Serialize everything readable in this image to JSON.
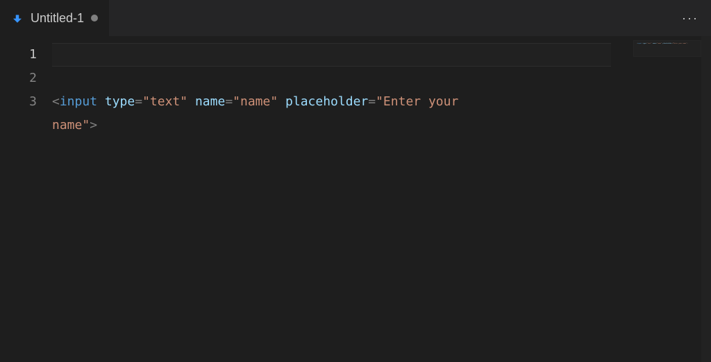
{
  "tabs": [
    {
      "label": "Untitled-1",
      "icon": "file-arrow-icon",
      "modified": true,
      "active": true
    }
  ],
  "editor": {
    "lineNumbers": [
      "1",
      "2",
      "3"
    ],
    "activeLine": 1,
    "code": {
      "line3": {
        "open": "<",
        "tag": "input",
        "sp": " ",
        "attr1": "type",
        "eq": "=",
        "val1": "\"text\"",
        "attr2": "name",
        "val2": "\"name\"",
        "attr3": "placeholder",
        "val3": "\"Enter your name\"",
        "close": ">"
      }
    }
  },
  "colors": {
    "background": "#1e1e1e",
    "tabBar": "#252526",
    "text": "#d4d4d4",
    "lineNumber": "#858585",
    "activeLineNumber": "#c6c6c6",
    "punct": "#808080",
    "tag": "#569cd6",
    "attr": "#9cdcfe",
    "str": "#ce9178"
  }
}
